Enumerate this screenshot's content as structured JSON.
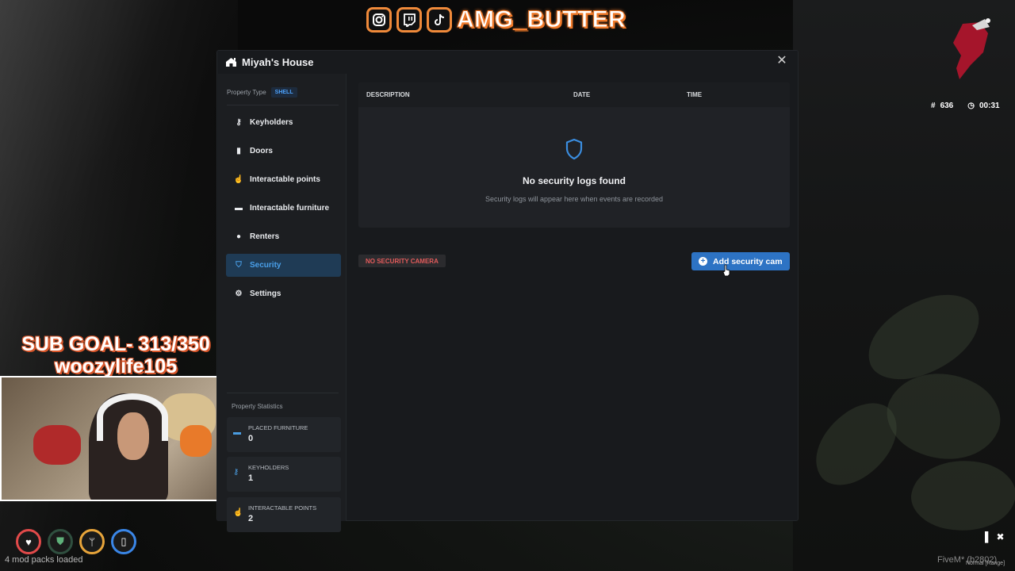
{
  "overlay": {
    "social_handle": "AMG_BUTTER",
    "social_icons": [
      "instagram-icon",
      "twitch-icon",
      "tiktok-icon"
    ],
    "sub_goal_line1": "SUB GOAL- 313/350",
    "sub_goal_line2": "woozylife105",
    "player_id": "636",
    "clock": "00:31",
    "mod_packs": "4 mod packs loaded",
    "fivem_build": "FiveM* (b2802)",
    "voice_mode": "Normal [Range]"
  },
  "modal": {
    "title": "Miyah's House",
    "property_type_label": "Property Type",
    "property_type_value": "SHELL",
    "nav": [
      {
        "label": "Keyholders",
        "icon": "key-icon"
      },
      {
        "label": "Doors",
        "icon": "door-icon"
      },
      {
        "label": "Interactable points",
        "icon": "hand-pointer-icon"
      },
      {
        "label": "Interactable furniture",
        "icon": "couch-icon"
      },
      {
        "label": "Renters",
        "icon": "user-icon"
      },
      {
        "label": "Security",
        "icon": "shield-icon",
        "active": true
      },
      {
        "label": "Settings",
        "icon": "gear-icon"
      }
    ],
    "stats_title": "Property Statistics",
    "stats": [
      {
        "label": "PLACED FURNITURE",
        "value": "0"
      },
      {
        "label": "KEYHOLDERS",
        "value": "1"
      },
      {
        "label": "INTERACTABLE POINTS",
        "value": "2"
      }
    ],
    "logs": {
      "columns": [
        "DESCRIPTION",
        "DATE",
        "TIME"
      ],
      "empty_title": "No security logs found",
      "empty_subtitle": "Security logs will appear here when events are recorded"
    },
    "camera_status": "NO SECURITY CAMERA",
    "add_camera_label": "Add security cam"
  },
  "colors": {
    "accent": "#2d73c4",
    "active_nav_bg": "#1f3b55",
    "danger_text": "#e35b5b",
    "modal_bg": "#181a1d"
  }
}
